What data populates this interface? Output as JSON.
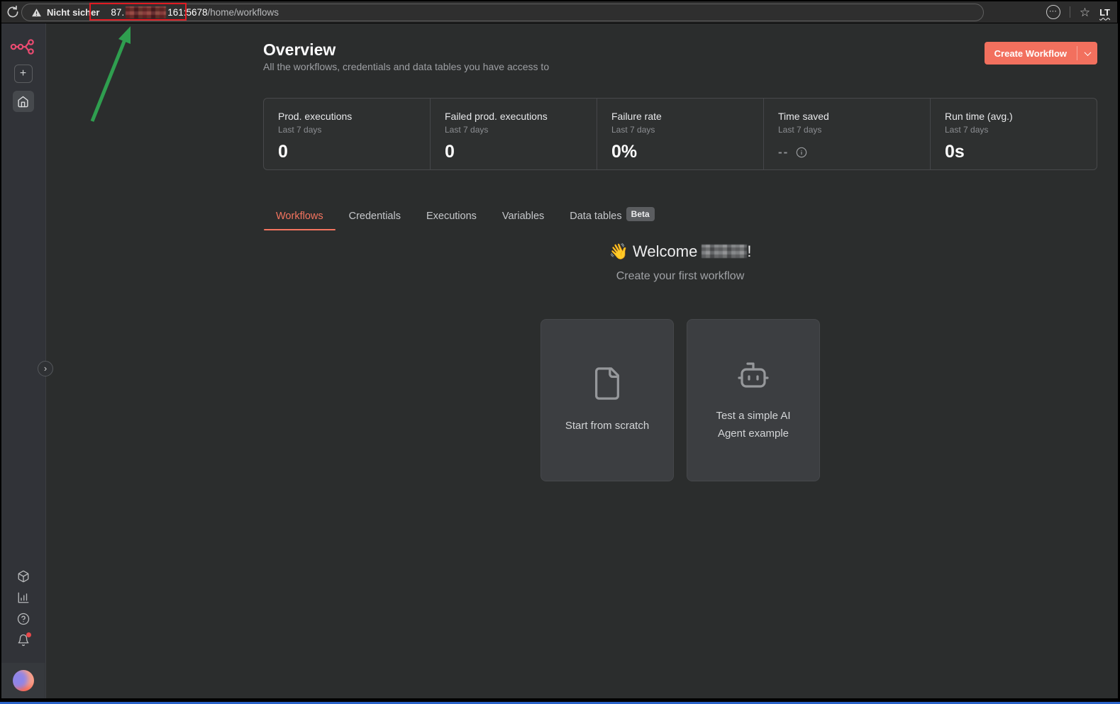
{
  "browser": {
    "security_warning": "Nicht sicher",
    "url": {
      "prefix": "87.",
      "suffix": "161:5678",
      "path": "/home/workflows"
    },
    "extension_label": "LT"
  },
  "page": {
    "title": "Overview",
    "subtitle": "All the workflows, credentials and data tables you have access to",
    "create_workflow_label": "Create Workflow"
  },
  "stats": {
    "cards": [
      {
        "title": "Prod. executions",
        "period": "Last 7 days",
        "value": "0"
      },
      {
        "title": "Failed prod. executions",
        "period": "Last 7 days",
        "value": "0"
      },
      {
        "title": "Failure rate",
        "period": "Last 7 days",
        "value": "0%"
      },
      {
        "title": "Time saved",
        "period": "Last 7 days",
        "value": "--"
      },
      {
        "title": "Run time (avg.)",
        "period": "Last 7 days",
        "value": "0s"
      }
    ]
  },
  "tabs": {
    "items": [
      {
        "label": "Workflows",
        "active": true
      },
      {
        "label": "Credentials",
        "active": false
      },
      {
        "label": "Executions",
        "active": false
      },
      {
        "label": "Variables",
        "active": false
      },
      {
        "label": "Data tables",
        "active": false
      }
    ],
    "beta_badge": "Beta"
  },
  "welcome": {
    "emoji": "👋",
    "greeting": "Welcome",
    "punctuation": "!",
    "subtitle": "Create your first workflow"
  },
  "starters": {
    "cards": [
      {
        "label": "Start from scratch"
      },
      {
        "label": "Test a simple AI Agent example"
      }
    ]
  },
  "colors": {
    "accent": "#f2705e",
    "logo_pink": "#ea4b71",
    "annotation_red": "#e11b22",
    "annotation_green": "#2f9e4f"
  }
}
